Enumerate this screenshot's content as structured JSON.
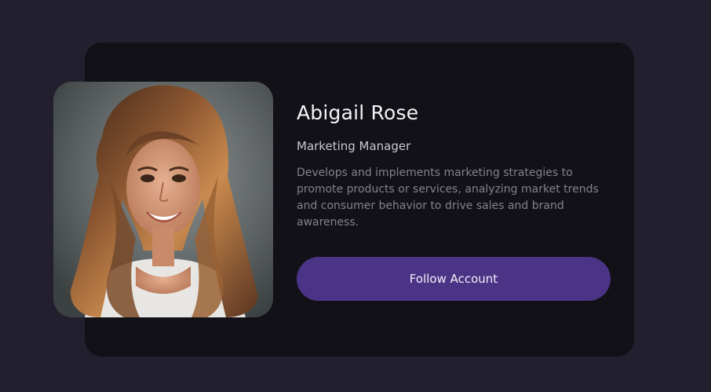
{
  "profile": {
    "name": "Abigail Rose",
    "title": "Marketing Manager",
    "description": "Develops and implements marketing strategies to promote products or services, analyzing market trends and consumer behavior to drive sales and brand awareness.",
    "photo_icon": "profile-photo"
  },
  "actions": {
    "follow_label": "Follow Account"
  },
  "colors": {
    "background": "#221f2e",
    "card": "#121117",
    "accent": "#4b3486"
  }
}
